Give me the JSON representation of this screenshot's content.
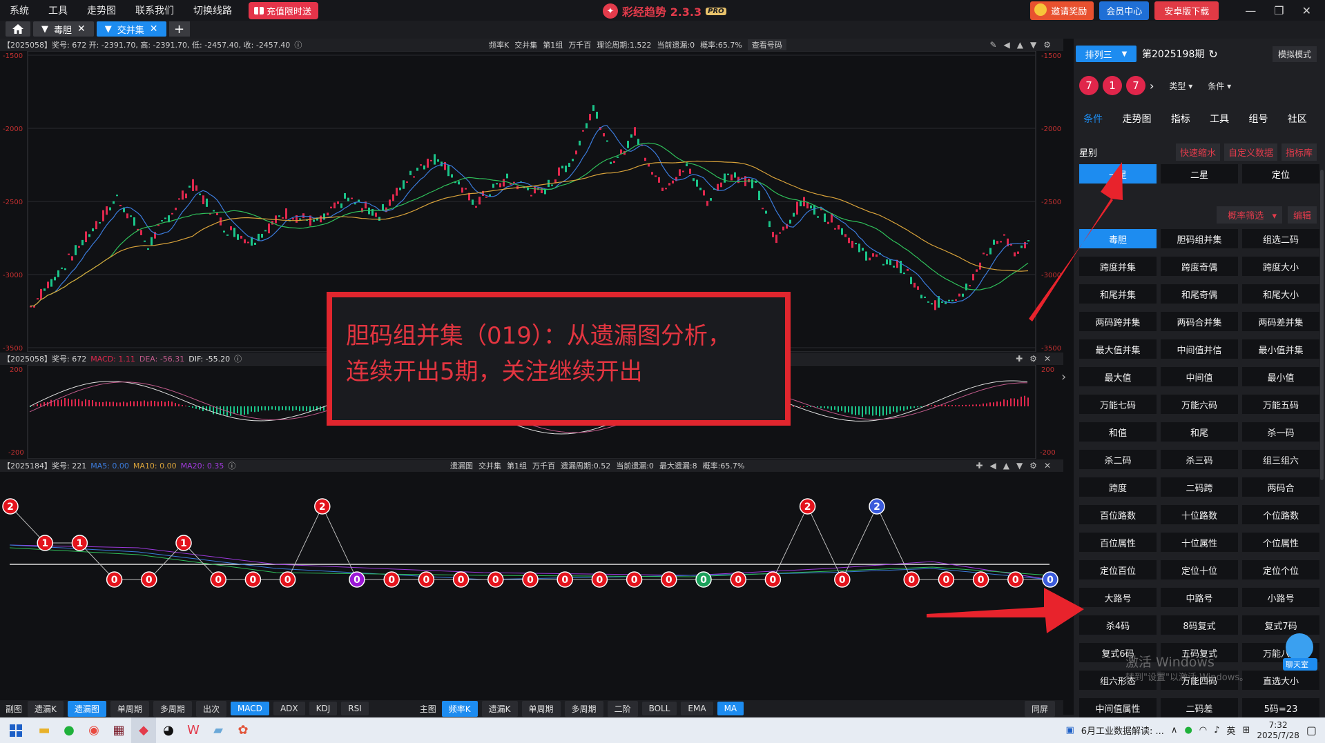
{
  "menu": [
    "系统",
    "工具",
    "走势图",
    "联系我们",
    "切换线路"
  ],
  "promo": "充值限时送",
  "app": {
    "title": "彩经趋势 2.3.3",
    "badge": "PRO"
  },
  "top_buttons": {
    "invite": "邀请奖励",
    "member": "会员中心",
    "android": "安卓版下载"
  },
  "tabs": [
    {
      "label": "毒胆"
    },
    {
      "label": "交并集"
    }
  ],
  "main_panel": {
    "header_left": "【2025058】奖号: 672  开: -2391.70, 高: -2391.70, 低: -2457.40, 收: -2457.40",
    "header_center": [
      "频率K",
      "交并集",
      "第1组",
      "万千百",
      "理论周期:1.522",
      "当前遗漏:0",
      "概率:65.7%",
      "查看号码"
    ],
    "y_left": [
      "-1500",
      "-2000",
      "-2500",
      "-3000",
      "-3500"
    ],
    "y_right": [
      "-1500",
      "-2000",
      "-2500",
      "-3000",
      "-3500"
    ]
  },
  "macd_panel": {
    "header_issue": "【2025058】奖号: 672",
    "macd": "MACD: 1.11",
    "dea": "DEA: -56.31",
    "dif": "DIF: -55.20",
    "y_left": [
      "200",
      "-200"
    ],
    "y_right": [
      "200",
      "-200"
    ]
  },
  "miss_panel": {
    "header_issue": "【2025184】奖号: 221",
    "ma5": "MA5: 0.00",
    "ma10": "MA10: 0.00",
    "ma20": "MA20: 0.35",
    "header_center": [
      "遗漏图",
      "交并集",
      "第1组",
      "万千百",
      "遗漏周期:0.52",
      "当前遗漏:0",
      "最大遗漏:8",
      "概率:65.7%"
    ],
    "points": [
      2,
      1,
      1,
      0,
      0,
      1,
      0,
      0,
      0,
      2,
      0,
      0,
      0,
      0,
      0,
      0,
      0,
      0,
      0,
      0,
      0,
      0,
      0,
      2,
      0,
      2,
      0,
      0,
      0,
      0,
      0
    ],
    "special_colors": {
      "10": "#9b18d6",
      "20": "#1aa05a",
      "25": "#3b5bdb",
      "30": "#3b5bdb"
    }
  },
  "annotation": {
    "line1": "胆码组并集（019）：从遗漏图分析，",
    "line2": "连续开出5期，关注继续开出"
  },
  "chart_bottom_left": {
    "label": "副图",
    "buttons": [
      "遗漏K",
      "遗漏图",
      "单周期",
      "多周期",
      "出次",
      "MACD",
      "ADX",
      "KDJ",
      "RSI"
    ],
    "active": [
      "遗漏图",
      "MACD"
    ]
  },
  "chart_bottom_mid": {
    "label": "主图",
    "buttons": [
      "频率K",
      "遗漏K",
      "单周期",
      "多周期",
      "二阶",
      "BOLL",
      "EMA",
      "MA"
    ],
    "active": [
      "频率K",
      "MA"
    ]
  },
  "chart_bottom_right": "同屏",
  "sidebar": {
    "lottery": "排列三",
    "issue": "第2025198期",
    "mock": "模拟模式",
    "balls": [
      "7",
      "1",
      "7"
    ],
    "type_label": "类型",
    "cond_label": "条件",
    "tabs": [
      "条件",
      "走势图",
      "指标",
      "工具",
      "组号",
      "社区"
    ],
    "star_label": "星别",
    "star_tags": [
      "快速缩水",
      "自定义数据",
      "指标库"
    ],
    "stars": [
      "一星",
      "二星",
      "定位"
    ],
    "filter": [
      "概率筛选",
      "编辑"
    ],
    "grid": [
      "毒胆",
      "胆码组并集",
      "组选二码",
      "跨度并集",
      "跨度奇偶",
      "跨度大小",
      "和尾并集",
      "和尾奇偶",
      "和尾大小",
      "两码跨并集",
      "两码合并集",
      "两码差并集",
      "最大值并集",
      "中间值并信",
      "最小值并集",
      "最大值",
      "中间值",
      "最小值",
      "万能七码",
      "万能六码",
      "万能五码",
      "和值",
      "和尾",
      "杀一码",
      "杀二码",
      "杀三码",
      "组三组六",
      "跨度",
      "二码跨",
      "两码合",
      "百位路数",
      "十位路数",
      "个位路数",
      "百位属性",
      "十位属性",
      "个位属性",
      "定位百位",
      "定位十位",
      "定位个位",
      "大路号",
      "中路号",
      "小路号",
      "杀4码",
      "8码复式",
      "复式7码",
      "复式6码",
      "五码复式",
      "万能八码",
      "组六形态",
      "万能四码",
      "直选大小",
      "中间值属性",
      "二码差",
      "5码=23"
    ]
  },
  "watermark": {
    "line1": "激活 Windows",
    "line2": "转到\"设置\"以激活 Windows。"
  },
  "chat_label": "聊天室",
  "taskbar": {
    "news": "6月工业数据解读: ...",
    "lang": "英",
    "time": "7:32",
    "date": "2025/7/28"
  }
}
